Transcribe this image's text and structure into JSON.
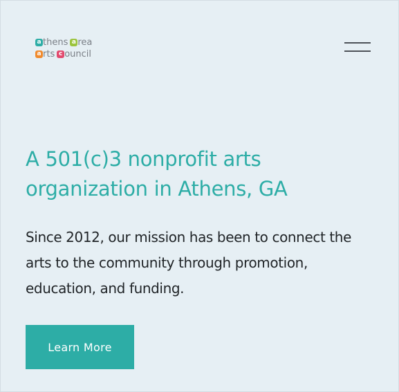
{
  "logo": {
    "line1": [
      {
        "badge": "a",
        "color": "#2dada6",
        "text": "thens"
      },
      {
        "badge": "a",
        "color": "#9cc43e",
        "text": "rea"
      }
    ],
    "line2": [
      {
        "badge": "a",
        "color": "#f08a2c",
        "text": "rts"
      },
      {
        "badge": "c",
        "color": "#e24a6e",
        "text": "ouncil"
      }
    ]
  },
  "header": {
    "menu_icon": "hamburger-menu-icon"
  },
  "hero": {
    "headline": "A 501(c)3 nonprofit arts organization in Athens, GA",
    "description": "Since 2012, our mission has been to connect the arts to the community through promotion, education, and funding.",
    "cta_label": "Learn More"
  },
  "colors": {
    "accent": "#2dada6",
    "background": "#e6eff4",
    "text": "#1f2326"
  }
}
